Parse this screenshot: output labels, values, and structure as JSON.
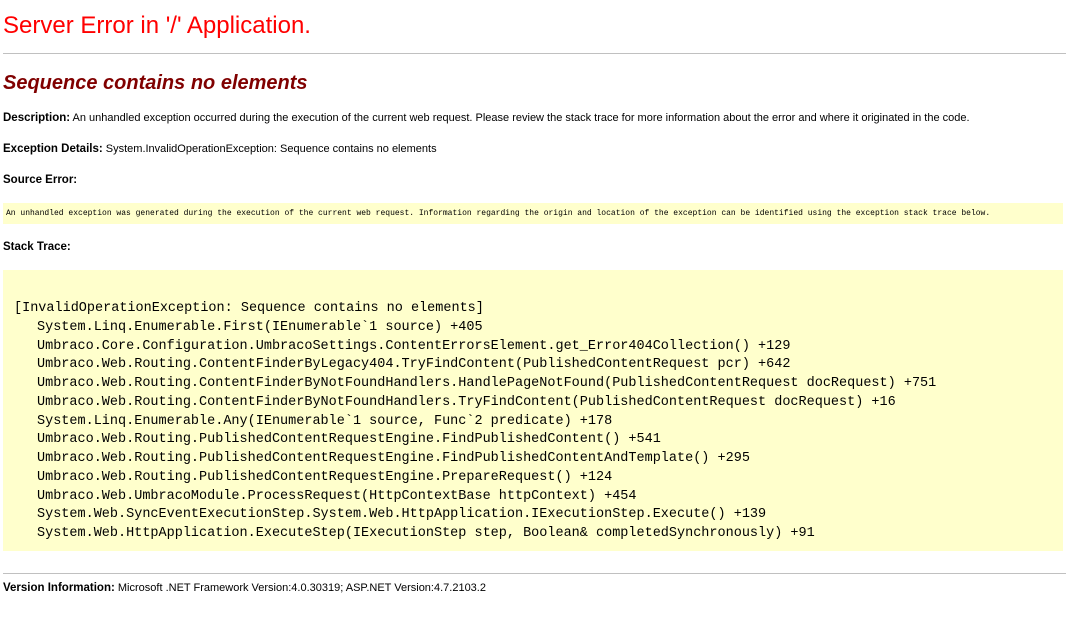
{
  "page": {
    "title": "Server Error in '/' Application.",
    "error_message": "Sequence contains no elements"
  },
  "description": {
    "label": "Description:",
    "text": "An unhandled exception occurred during the execution of the current web request. Please review the stack trace for more information about the error and where it originated in the code."
  },
  "exception_details": {
    "label": "Exception Details:",
    "text": "System.InvalidOperationException: Sequence contains no elements"
  },
  "source_error": {
    "label": "Source Error:",
    "text": "An unhandled exception was generated during the execution of the current web request. Information regarding the origin and location of the exception can be identified using the exception stack trace below."
  },
  "stack_trace": {
    "label": "Stack Trace:",
    "header": "[InvalidOperationException: Sequence contains no elements]",
    "lines": [
      "System.Linq.Enumerable.First(IEnumerable`1 source) +405",
      "Umbraco.Core.Configuration.UmbracoSettings.ContentErrorsElement.get_Error404Collection() +129",
      "Umbraco.Web.Routing.ContentFinderByLegacy404.TryFindContent(PublishedContentRequest pcr) +642",
      "Umbraco.Web.Routing.ContentFinderByNotFoundHandlers.HandlePageNotFound(PublishedContentRequest docRequest) +751",
      "Umbraco.Web.Routing.ContentFinderByNotFoundHandlers.TryFindContent(PublishedContentRequest docRequest) +16",
      "System.Linq.Enumerable.Any(IEnumerable`1 source, Func`2 predicate) +178",
      "Umbraco.Web.Routing.PublishedContentRequestEngine.FindPublishedContent() +541",
      "Umbraco.Web.Routing.PublishedContentRequestEngine.FindPublishedContentAndTemplate() +295",
      "Umbraco.Web.Routing.PublishedContentRequestEngine.PrepareRequest() +124",
      "Umbraco.Web.UmbracoModule.ProcessRequest(HttpContextBase httpContext) +454",
      "System.Web.SyncEventExecutionStep.System.Web.HttpApplication.IExecutionStep.Execute() +139",
      "System.Web.HttpApplication.ExecuteStep(IExecutionStep step, Boolean& completedSynchronously) +91"
    ]
  },
  "version_information": {
    "label": "Version Information:",
    "text": "Microsoft .NET Framework Version:4.0.30319; ASP.NET Version:4.7.2103.2"
  },
  "colors": {
    "title": "#ff0000",
    "error_message": "#800000",
    "code_background": "#ffffcc",
    "rule": "#c0c0c0"
  }
}
